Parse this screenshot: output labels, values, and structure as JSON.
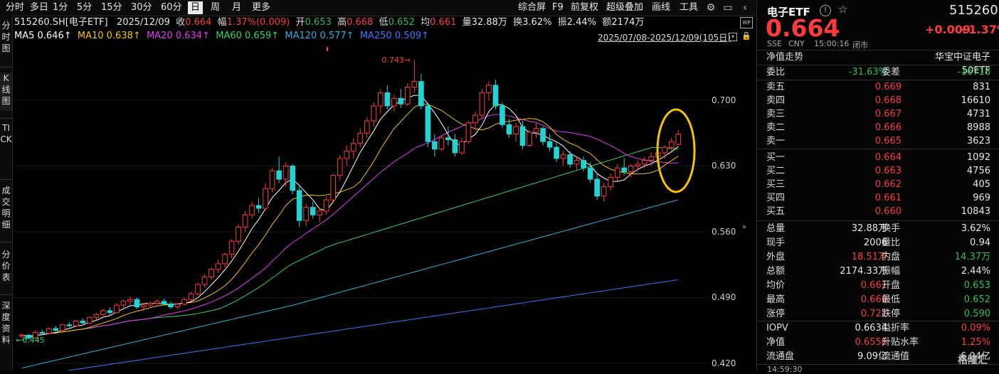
{
  "toolbar": {
    "periods": [
      "分时",
      "多日",
      "1分",
      "5分",
      "15分",
      "30分",
      "60分",
      "日",
      "周",
      "月",
      "更多"
    ],
    "active_period": "日",
    "tools": [
      "综合屏",
      "F9",
      "前复权",
      "超级叠加",
      "画线",
      "工具"
    ]
  },
  "left_tabs": [
    "分时图",
    "K线图",
    "TICK",
    "成交明细",
    "分价表",
    "深度资料"
  ],
  "info": {
    "code": "515260.SH[电子ETF]",
    "date": "2025/12/09",
    "close_label": "收",
    "close": "0.664",
    "chg_label": "幅",
    "chg": "1.37%(0.009)",
    "open_label": "开",
    "open": "0.653",
    "high_label": "高",
    "high": "0.668",
    "low_label": "低",
    "low": "0.652",
    "avg_label": "均",
    "avg": "0.661",
    "vol_label": "量",
    "vol": "32.88万",
    "turn_label": "换",
    "turn": "3.62%",
    "amp_label": "振",
    "amp": "2.44%",
    "amt_label": "额",
    "amt": "2174万"
  },
  "ma": {
    "ma5": "MA5 0.646↑",
    "ma10": "MA10 0.638↑",
    "ma20": "MA20 0.634↑",
    "ma60": "MA60 0.659↑",
    "ma120": "MA120 0.577↑",
    "ma250": "MA250 0.509↑"
  },
  "range": "2025/07/08-2025/12/09(105日)",
  "chart": {
    "ticks": [
      "0.700",
      "0.630",
      "0.560",
      "0.490",
      "0.420"
    ],
    "ann_high": "0.743",
    "ann_low": "0.445"
  },
  "colors": {
    "up": "#ff3b3b",
    "down": "#22d3d3",
    "ma5": "#ffffff",
    "ma10": "#f5c400",
    "ma20": "#e03cf0",
    "ma60": "#31d36c",
    "ma120": "#31b0e0",
    "ma250": "#3a7bff",
    "circle": "#f5c400"
  },
  "chart_data": {
    "type": "candlestick",
    "x_range": [
      "2025/07/08",
      "2025/12/09"
    ],
    "y_ticks": [
      0.42,
      0.49,
      0.56,
      0.63,
      0.7
    ],
    "ohlc": [
      [
        0.449,
        0.452,
        0.447,
        0.45
      ],
      [
        0.45,
        0.451,
        0.445,
        0.447
      ],
      [
        0.447,
        0.455,
        0.446,
        0.453
      ],
      [
        0.453,
        0.456,
        0.45,
        0.452
      ],
      [
        0.452,
        0.458,
        0.451,
        0.457
      ],
      [
        0.457,
        0.46,
        0.454,
        0.455
      ],
      [
        0.455,
        0.462,
        0.454,
        0.461
      ],
      [
        0.461,
        0.464,
        0.458,
        0.46
      ],
      [
        0.46,
        0.466,
        0.459,
        0.465
      ],
      [
        0.465,
        0.468,
        0.462,
        0.463
      ],
      [
        0.463,
        0.47,
        0.462,
        0.469
      ],
      [
        0.469,
        0.474,
        0.466,
        0.472
      ],
      [
        0.472,
        0.478,
        0.47,
        0.476
      ],
      [
        0.476,
        0.48,
        0.472,
        0.474
      ],
      [
        0.474,
        0.484,
        0.473,
        0.482
      ],
      [
        0.482,
        0.488,
        0.479,
        0.486
      ],
      [
        0.486,
        0.491,
        0.482,
        0.488
      ],
      [
        0.488,
        0.49,
        0.478,
        0.48
      ],
      [
        0.48,
        0.484,
        0.476,
        0.482
      ],
      [
        0.482,
        0.486,
        0.479,
        0.484
      ],
      [
        0.484,
        0.488,
        0.481,
        0.486
      ],
      [
        0.486,
        0.489,
        0.482,
        0.483
      ],
      [
        0.483,
        0.486,
        0.478,
        0.48
      ],
      [
        0.48,
        0.484,
        0.478,
        0.483
      ],
      [
        0.483,
        0.49,
        0.481,
        0.488
      ],
      [
        0.488,
        0.496,
        0.486,
        0.494
      ],
      [
        0.494,
        0.506,
        0.492,
        0.504
      ],
      [
        0.504,
        0.515,
        0.501,
        0.512
      ],
      [
        0.512,
        0.522,
        0.509,
        0.52
      ],
      [
        0.52,
        0.53,
        0.516,
        0.526
      ],
      [
        0.526,
        0.538,
        0.522,
        0.536
      ],
      [
        0.536,
        0.552,
        0.532,
        0.55
      ],
      [
        0.55,
        0.568,
        0.546,
        0.565
      ],
      [
        0.565,
        0.582,
        0.56,
        0.578
      ],
      [
        0.578,
        0.592,
        0.574,
        0.588
      ],
      [
        0.588,
        0.596,
        0.58,
        0.585
      ],
      [
        0.585,
        0.612,
        0.583,
        0.606
      ],
      [
        0.606,
        0.628,
        0.602,
        0.625
      ],
      [
        0.625,
        0.64,
        0.612,
        0.616
      ],
      [
        0.616,
        0.634,
        0.608,
        0.63
      ],
      [
        0.63,
        0.632,
        0.6,
        0.604
      ],
      [
        0.604,
        0.61,
        0.565,
        0.572
      ],
      [
        0.572,
        0.59,
        0.566,
        0.586
      ],
      [
        0.586,
        0.592,
        0.574,
        0.578
      ],
      [
        0.578,
        0.585,
        0.57,
        0.582
      ],
      [
        0.582,
        0.598,
        0.578,
        0.594
      ],
      [
        0.594,
        0.622,
        0.59,
        0.62
      ],
      [
        0.62,
        0.642,
        0.615,
        0.638
      ],
      [
        0.638,
        0.652,
        0.63,
        0.646
      ],
      [
        0.646,
        0.66,
        0.638,
        0.654
      ],
      [
        0.654,
        0.67,
        0.65,
        0.665
      ],
      [
        0.665,
        0.682,
        0.66,
        0.678
      ],
      [
        0.678,
        0.698,
        0.672,
        0.694
      ],
      [
        0.694,
        0.712,
        0.686,
        0.708
      ],
      [
        0.708,
        0.716,
        0.69,
        0.694
      ],
      [
        0.694,
        0.706,
        0.688,
        0.702
      ],
      [
        0.702,
        0.712,
        0.692,
        0.696
      ],
      [
        0.696,
        0.718,
        0.694,
        0.714
      ],
      [
        0.714,
        0.743,
        0.708,
        0.72
      ],
      [
        0.72,
        0.728,
        0.69,
        0.694
      ],
      [
        0.694,
        0.698,
        0.65,
        0.656
      ],
      [
        0.656,
        0.664,
        0.64,
        0.648
      ],
      [
        0.648,
        0.662,
        0.646,
        0.66
      ],
      [
        0.66,
        0.672,
        0.652,
        0.658
      ],
      [
        0.658,
        0.664,
        0.64,
        0.644
      ],
      [
        0.644,
        0.66,
        0.642,
        0.656
      ],
      [
        0.656,
        0.678,
        0.654,
        0.676
      ],
      [
        0.676,
        0.688,
        0.668,
        0.684
      ],
      [
        0.684,
        0.712,
        0.68,
        0.708
      ],
      [
        0.708,
        0.72,
        0.7,
        0.716
      ],
      [
        0.716,
        0.722,
        0.69,
        0.694
      ],
      [
        0.694,
        0.698,
        0.67,
        0.674
      ],
      [
        0.674,
        0.68,
        0.66,
        0.664
      ],
      [
        0.664,
        0.676,
        0.656,
        0.672
      ],
      [
        0.672,
        0.678,
        0.648,
        0.652
      ],
      [
        0.652,
        0.668,
        0.65,
        0.666
      ],
      [
        0.666,
        0.676,
        0.66,
        0.67
      ],
      [
        0.67,
        0.672,
        0.652,
        0.656
      ],
      [
        0.656,
        0.664,
        0.646,
        0.65
      ],
      [
        0.65,
        0.656,
        0.634,
        0.638
      ],
      [
        0.638,
        0.646,
        0.63,
        0.642
      ],
      [
        0.642,
        0.646,
        0.628,
        0.632
      ],
      [
        0.632,
        0.64,
        0.626,
        0.636
      ],
      [
        0.636,
        0.64,
        0.624,
        0.628
      ],
      [
        0.628,
        0.634,
        0.612,
        0.616
      ],
      [
        0.616,
        0.622,
        0.594,
        0.598
      ],
      [
        0.598,
        0.612,
        0.592,
        0.608
      ],
      [
        0.608,
        0.622,
        0.604,
        0.618
      ],
      [
        0.618,
        0.632,
        0.614,
        0.628
      ],
      [
        0.628,
        0.638,
        0.62,
        0.624
      ],
      [
        0.624,
        0.632,
        0.618,
        0.63
      ],
      [
        0.63,
        0.636,
        0.624,
        0.632
      ],
      [
        0.632,
        0.64,
        0.628,
        0.636
      ],
      [
        0.636,
        0.644,
        0.63,
        0.64
      ],
      [
        0.64,
        0.648,
        0.634,
        0.644
      ],
      [
        0.644,
        0.652,
        0.638,
        0.65
      ],
      [
        0.65,
        0.66,
        0.646,
        0.656
      ],
      [
        0.653,
        0.668,
        0.652,
        0.664
      ]
    ]
  },
  "rpanel": {
    "title": "电子ETF",
    "code": "515260",
    "price": "0.664",
    "chg": "+0.009",
    "chg_pct": "+1.37%",
    "meta": [
      "SSE",
      "CNY",
      "15:00:16",
      "闭市"
    ],
    "nav_trend": "净值走势",
    "tracking": "华宝中证电子50ETF",
    "weibi_label": "委比",
    "weibi": "-31.63%",
    "weicha_label": "委差",
    "weicha": "-16718",
    "asks": [
      {
        "label": "卖五",
        "price": "0.669",
        "vol": "831"
      },
      {
        "label": "卖四",
        "price": "0.668",
        "vol": "16610"
      },
      {
        "label": "卖三",
        "price": "0.667",
        "vol": "4731"
      },
      {
        "label": "卖二",
        "price": "0.666",
        "vol": "8988"
      },
      {
        "label": "卖一",
        "price": "0.665",
        "vol": "3623"
      }
    ],
    "bids": [
      {
        "label": "买一",
        "price": "0.664",
        "vol": "1092"
      },
      {
        "label": "买二",
        "price": "0.663",
        "vol": "4756"
      },
      {
        "label": "买三",
        "price": "0.662",
        "vol": "405"
      },
      {
        "label": "买四",
        "price": "0.661",
        "vol": "969"
      },
      {
        "label": "买五",
        "price": "0.660",
        "vol": "10843"
      }
    ],
    "stats": [
      {
        "l1": "总量",
        "v1": "32.88万",
        "c1": "white",
        "l2": "换手",
        "v2": "3.62%",
        "c2": "white"
      },
      {
        "l1": "现手",
        "v1": "2006",
        "c1": "white",
        "l2": "量比",
        "v2": "0.94",
        "c2": "white"
      },
      {
        "l1": "外盘",
        "v1": "18.51万",
        "c1": "red",
        "l2": "内盘",
        "v2": "14.37万",
        "c2": "green"
      },
      {
        "l1": "总额",
        "v1": "2174.33万",
        "c1": "white",
        "l2": "振幅",
        "v2": "2.44%",
        "c2": "white"
      },
      {
        "l1": "均价",
        "v1": "0.661",
        "c1": "red",
        "l2": "开盘",
        "v2": "0.653",
        "c2": "green"
      },
      {
        "l1": "最高",
        "v1": "0.668",
        "c1": "red",
        "l2": "最低",
        "v2": "0.652",
        "c2": "green"
      },
      {
        "l1": "涨停",
        "v1": "0.721",
        "c1": "red",
        "l2": "跌停",
        "v2": "0.590",
        "c2": "green"
      }
    ],
    "stats2": [
      {
        "l1": "IOPV",
        "v1": "0.6634",
        "c1": "white",
        "l2": "溢折率",
        "v2": "0.09%",
        "c2": "red"
      },
      {
        "l1": "净值",
        "v1": "0.6558",
        "c1": "red",
        "l2": "升贴水率",
        "v2": "1.25%",
        "c2": "red"
      },
      {
        "l1": "流通盘",
        "v1": "9.09亿",
        "c1": "white",
        "l2": "流通值",
        "v2": "6.04亿",
        "c2": "white"
      }
    ],
    "last_row": "14:59:30",
    "watermark": "格隆汇"
  }
}
